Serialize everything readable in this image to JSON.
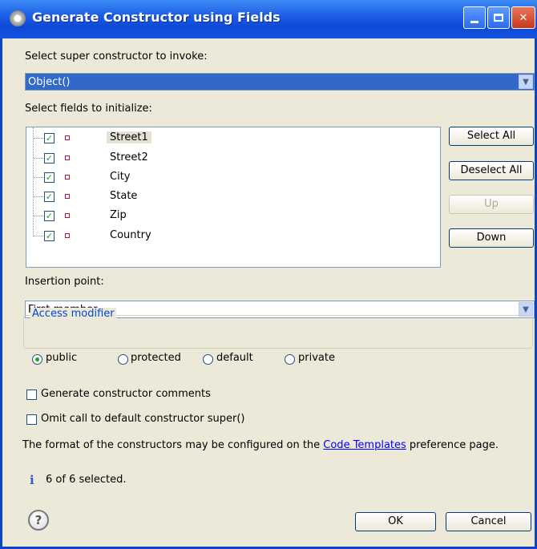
{
  "window": {
    "title": "Generate Constructor using Fields"
  },
  "super_constructor": {
    "label": "Select super constructor to invoke:",
    "value": "Object()"
  },
  "fields": {
    "label": "Select fields to initialize:",
    "items": [
      {
        "name": "Street1",
        "checked": true,
        "selected": true
      },
      {
        "name": "Street2",
        "checked": true,
        "selected": false
      },
      {
        "name": "City",
        "checked": true,
        "selected": false
      },
      {
        "name": "State",
        "checked": true,
        "selected": false
      },
      {
        "name": "Zip",
        "checked": true,
        "selected": false
      },
      {
        "name": "Country",
        "checked": true,
        "selected": false
      }
    ]
  },
  "buttons": {
    "select_all": "Select All",
    "deselect_all": "Deselect All",
    "up": "Up",
    "down": "Down",
    "ok": "OK",
    "cancel": "Cancel"
  },
  "insertion": {
    "label": "Insertion point:",
    "value": "First member"
  },
  "access": {
    "title": "Access modifier",
    "options": [
      "public",
      "protected",
      "default",
      "private"
    ],
    "selected": "public"
  },
  "options": {
    "comments": {
      "label": "Generate constructor comments",
      "checked": false
    },
    "omit_super": {
      "label": "Omit call to default constructor super()",
      "checked": false
    }
  },
  "format_note": {
    "before": "The format of the constructors may be configured on the ",
    "link": "Code Templates",
    "after": " preference page."
  },
  "status": {
    "text": "6 of 6 selected."
  },
  "colors": {
    "titlebar": "#0e49d6",
    "dialog_bg": "#ece9d8",
    "selection": "#3268c8",
    "check_green": "#21a121",
    "link": "#0000ff"
  }
}
